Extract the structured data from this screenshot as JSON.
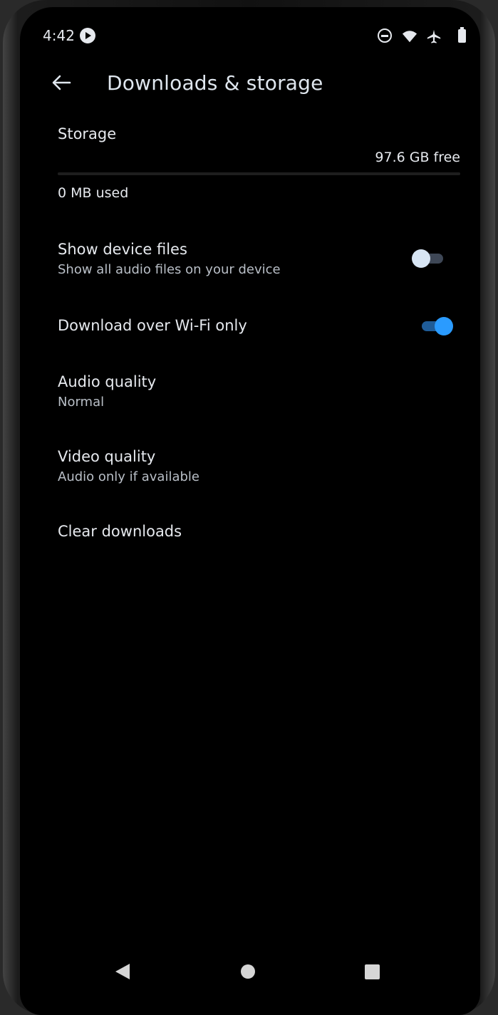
{
  "status_bar": {
    "time": "4:42",
    "icons": [
      "media-playing-icon",
      "do-not-disturb-icon",
      "wifi-icon",
      "airplane-mode-icon",
      "battery-icon"
    ]
  },
  "app_bar": {
    "back_icon": "arrow-left-icon",
    "title": "Downloads & storage"
  },
  "storage": {
    "title": "Storage",
    "free": "97.6 GB free",
    "used": "0 MB used",
    "used_fraction": 0.0
  },
  "settings": {
    "show_device_files": {
      "title": "Show device files",
      "subtitle": "Show all audio files on your device",
      "enabled": false
    },
    "download_wifi_only": {
      "title": "Download over Wi-Fi only",
      "enabled": true
    },
    "audio_quality": {
      "title": "Audio quality",
      "value": "Normal"
    },
    "video_quality": {
      "title": "Video quality",
      "value": "Audio only if available"
    },
    "clear_downloads": {
      "title": "Clear downloads"
    }
  },
  "nav_bar": {
    "icons": [
      "nav-back-icon",
      "nav-home-icon",
      "nav-recents-icon"
    ]
  },
  "colors": {
    "background": "#000000",
    "accent": "#2a9bff",
    "text_primary": "#e6e9ee",
    "text_secondary": "#b9bfc7"
  }
}
